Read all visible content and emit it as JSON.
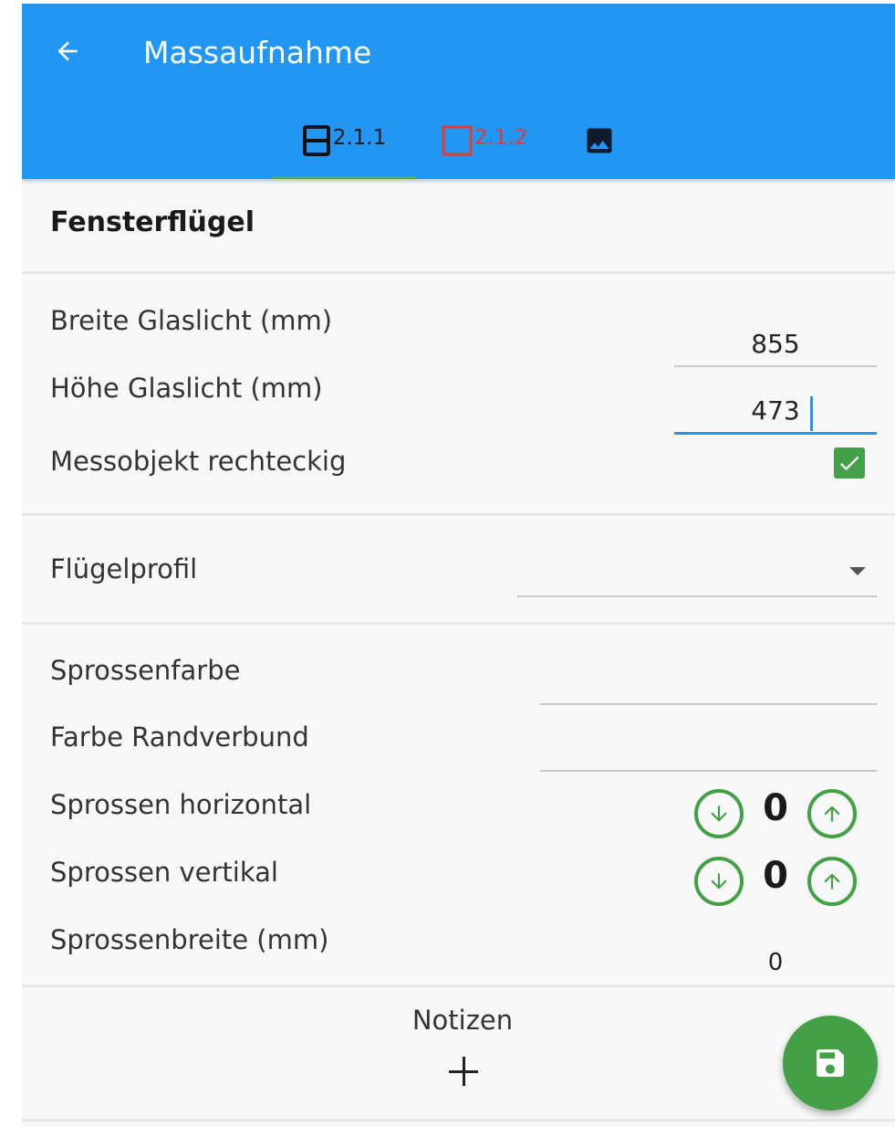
{
  "header": {
    "title": "Massaufnahme",
    "back_icon": "arrow-left-icon",
    "background": "#2196f3",
    "tabs": [
      {
        "label": "2.1.1",
        "icon": "window-split-icon",
        "active": true
      },
      {
        "label": "2.1.2",
        "icon": "window-empty-icon",
        "active": false,
        "status": "error"
      },
      {
        "label": "",
        "icon": "image-icon",
        "active": false
      }
    ]
  },
  "section": {
    "title": "Fensterflügel"
  },
  "fields": {
    "breite": {
      "label": "Breite Glaslicht (mm)",
      "value": "855"
    },
    "hoehe": {
      "label": "Höhe Glaslicht (mm)",
      "value": "473"
    },
    "rechteckig": {
      "label": "Messobjekt rechteckig",
      "checked": true
    },
    "fluegelprofil": {
      "label": "Flügelprofil",
      "value": ""
    },
    "sprossenfarbe": {
      "label": "Sprossenfarbe",
      "value": ""
    },
    "randverbund": {
      "label": "Farbe Randverbund",
      "value": ""
    },
    "sprossen_h": {
      "label": "Sprossen horizontal",
      "value": "0"
    },
    "sprossen_v": {
      "label": "Sprossen vertikal",
      "value": "0"
    },
    "sprossenbreite": {
      "label": "Sprossenbreite (mm)",
      "value": "0"
    }
  },
  "notes": {
    "label": "Notizen",
    "add_icon": "plus-icon"
  },
  "fab": {
    "icon": "save-icon"
  },
  "colors": {
    "accent": "#2196f3",
    "success": "#43a047",
    "error": "#e53935"
  }
}
